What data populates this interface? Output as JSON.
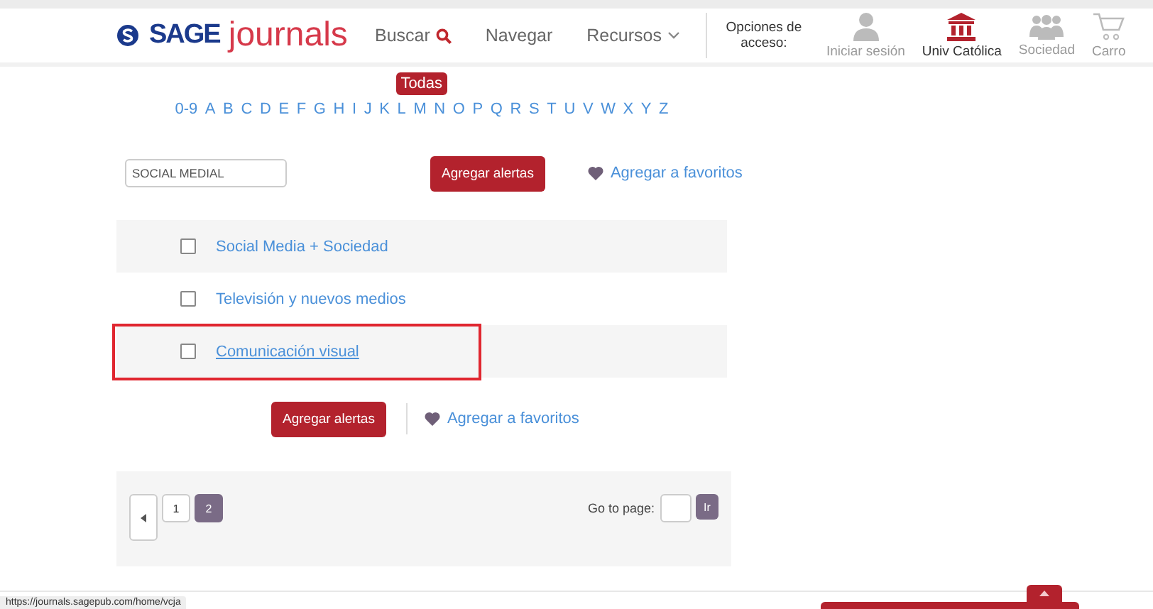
{
  "header": {
    "logo": {
      "brand": "SAGE",
      "product": "journals"
    },
    "nav": [
      {
        "label": "Buscar",
        "kind": "search"
      },
      {
        "label": "Navegar",
        "kind": "plain"
      },
      {
        "label": "Recursos",
        "kind": "dropdown"
      }
    ],
    "access_label": "Opciones de acceso:",
    "access": [
      {
        "label": "Iniciar sesión",
        "kind": "person",
        "active": false
      },
      {
        "label": "Univ Católica",
        "kind": "institution",
        "active": true
      },
      {
        "label": "Sociedad",
        "kind": "group",
        "active": false
      },
      {
        "label": "Carro",
        "kind": "cart",
        "active": false
      }
    ]
  },
  "alphabet": {
    "letters": [
      {
        "label": "0-9",
        "hovered": false
      },
      {
        "label": "A",
        "hovered": false
      },
      {
        "label": "B",
        "hovered": false
      },
      {
        "label": "C",
        "hovered": false
      },
      {
        "label": "D",
        "hovered": false
      },
      {
        "label": "E",
        "hovered": false
      },
      {
        "label": "F",
        "hovered": false
      },
      {
        "label": "G",
        "hovered": false
      },
      {
        "label": "H",
        "hovered": false
      },
      {
        "label": "I",
        "hovered": false
      },
      {
        "label": "J",
        "hovered": false
      },
      {
        "label": "K",
        "hovered": false
      },
      {
        "label": "L",
        "hovered": false
      },
      {
        "label": "M",
        "hovered": true
      },
      {
        "label": "N",
        "hovered": false
      },
      {
        "label": "O",
        "hovered": false
      },
      {
        "label": "P",
        "hovered": false
      },
      {
        "label": "Q",
        "hovered": false
      },
      {
        "label": "R",
        "hovered": false
      },
      {
        "label": "S",
        "hovered": false
      },
      {
        "label": "T",
        "hovered": false
      },
      {
        "label": "U",
        "hovered": false
      },
      {
        "label": "V",
        "hovered": false
      },
      {
        "label": "W",
        "hovered": false
      },
      {
        "label": "X",
        "hovered": false
      },
      {
        "label": "Y",
        "hovered": false
      },
      {
        "label": "Z",
        "hovered": false
      }
    ],
    "tooltip": "Todas"
  },
  "filter": {
    "value": "SOCIAL MEDIAL"
  },
  "actions": {
    "alerts": "Agregar alertas",
    "favorites": "Agregar a favoritos"
  },
  "results": [
    {
      "title": "Social Media + Sociedad",
      "checked": false,
      "highlighted": false,
      "underlined": false
    },
    {
      "title": "Televisión y nuevos medios",
      "checked": false,
      "highlighted": false,
      "underlined": false
    },
    {
      "title": "Comunicación visual",
      "checked": false,
      "highlighted": true,
      "underlined": true
    }
  ],
  "bottom_actions": {
    "alerts": "Agregar alertas",
    "favorites": "Agregar a favoritos"
  },
  "pagination": {
    "pages": [
      {
        "label": "1",
        "selected": false
      },
      {
        "label": "2",
        "selected": true
      }
    ],
    "goto_label": "Go to page:",
    "go": "Ir"
  },
  "status_bar": {
    "url": "https://journals.sagepub.com/home/vcja"
  }
}
